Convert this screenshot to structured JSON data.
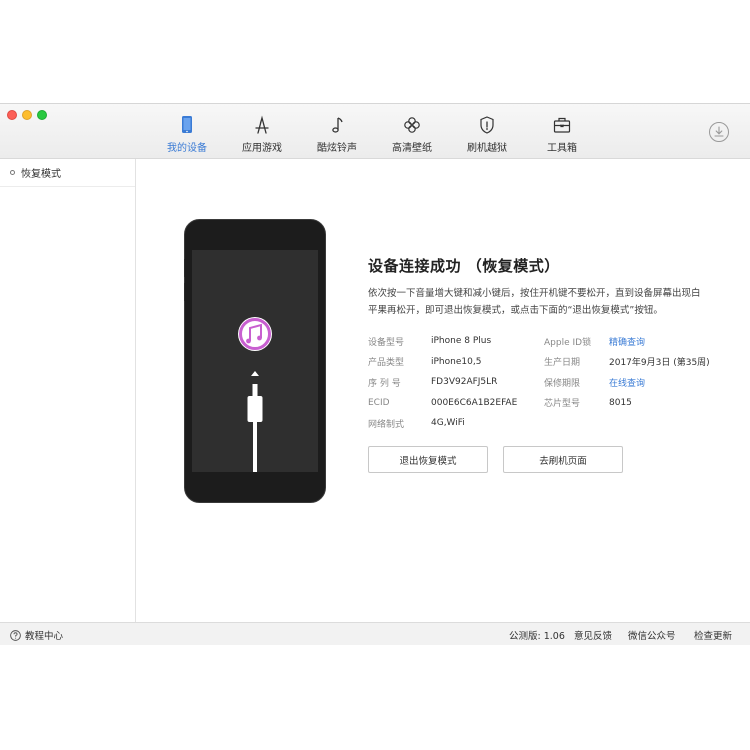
{
  "toolbar": {
    "items": [
      {
        "label": "我的设备",
        "icon": "phone-icon"
      },
      {
        "label": "应用游戏",
        "icon": "app-store-icon"
      },
      {
        "label": "酷炫铃声",
        "icon": "music-note-icon"
      },
      {
        "label": "高清壁纸",
        "icon": "flower-icon"
      },
      {
        "label": "刷机越狱",
        "icon": "shield-icon"
      },
      {
        "label": "工具箱",
        "icon": "toolbox-icon"
      }
    ],
    "active_index": 0
  },
  "sidebar": {
    "items": [
      {
        "label": "恢复模式"
      }
    ]
  },
  "device": {
    "title": "设备连接成功 （恢复模式）",
    "description": "依次按一下音量增大键和减小键后，按住开机键不要松开，直到设备屏幕出现白平果再松开，即可退出恢复模式，或点击下面的“退出恢复模式”按钮。",
    "specs": [
      {
        "label": "设备型号",
        "value": "iPhone 8 Plus",
        "label2": "Apple ID锁",
        "value2": "精确查询"
      },
      {
        "label": "产品类型",
        "value": "iPhone10,5",
        "label2": "生产日期",
        "value2": "2017年9月3日 (第35周)"
      },
      {
        "label": "序 列 号",
        "value": "FD3V92AFJ5LR",
        "label2": "保修期限",
        "value2": "在线查询"
      },
      {
        "label": "ECID",
        "value": "000E6C6A1B2EFAE",
        "label2": "芯片型号",
        "value2": "8015"
      },
      {
        "label": "网络制式",
        "value": "4G,WiFi",
        "label2": "",
        "value2": ""
      }
    ],
    "exit_button": "退出恢复模式",
    "flash_button": "去刷机页面"
  },
  "statusbar": {
    "help": "教程中心",
    "version": "公测版: 1.06",
    "feedback": "意见反馈",
    "wechat": "微信公众号",
    "update": "检查更新"
  },
  "colors": {
    "accent": "#3a7bd5",
    "phone_body": "#1c1c1c",
    "phone_screen": "#2f2f2f"
  }
}
